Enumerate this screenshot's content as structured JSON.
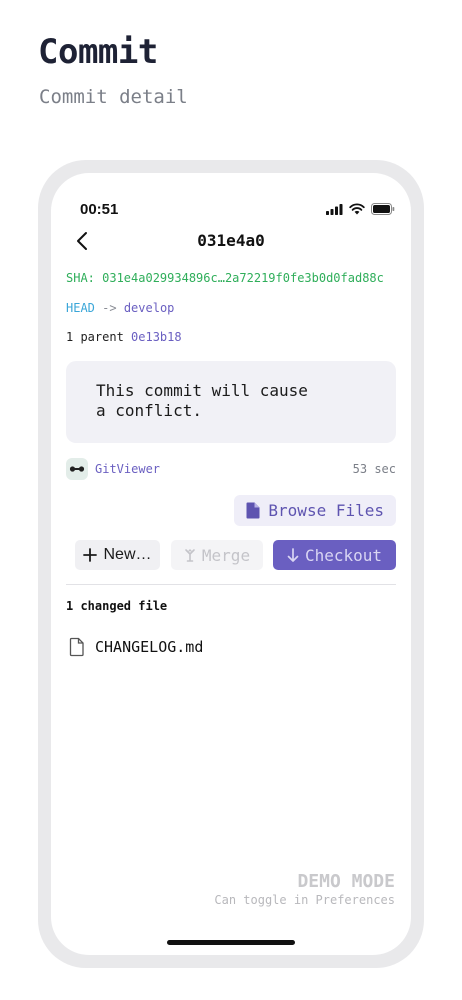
{
  "page": {
    "title": "Commit",
    "subtitle": "Commit detail"
  },
  "status_bar": {
    "time": "00:51",
    "icons": [
      "cellular-signal-icon",
      "wifi-icon",
      "battery-icon"
    ]
  },
  "nav": {
    "back_icon": "chevron-left-icon",
    "title": "031e4a0"
  },
  "commit": {
    "sha_text": "SHA: 031e4a029934896c…2a72219f0fe3b0d0fad88c",
    "ref_head": "HEAD",
    "ref_arrow": "->",
    "ref_branch": "develop",
    "parent_label": "1 parent",
    "parent_sha": "0e13b18",
    "message": "This commit will cause\na conflict.",
    "author": "GitViewer",
    "time_ago": "53 sec"
  },
  "actions": {
    "browse_files": "Browse Files",
    "new_label": "New…",
    "merge_label": "Merge",
    "checkout_label": "Checkout"
  },
  "files": {
    "summary": "1 changed file",
    "items": [
      {
        "name": "CHANGELOG.md"
      }
    ]
  },
  "demo": {
    "title": "DEMO MODE",
    "subtitle": "Can toggle in Preferences"
  },
  "colors": {
    "accent": "#6a5fc1",
    "sha_green": "#2fae5a",
    "head_blue": "#3aa6d8"
  }
}
